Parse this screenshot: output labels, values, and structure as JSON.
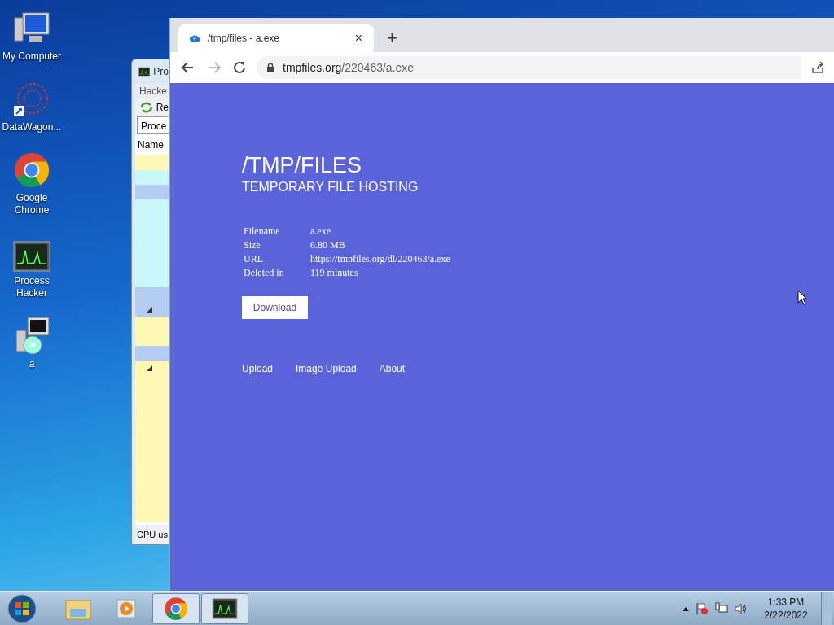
{
  "desktop_icons": [
    {
      "kind": "computer",
      "label": "My Computer"
    },
    {
      "kind": "web",
      "label": "DataWagon..."
    },
    {
      "kind": "chrome",
      "label": "Google Chrome"
    },
    {
      "kind": "monitor",
      "label": "Process Hacker"
    },
    {
      "kind": "installer",
      "label": "a"
    }
  ],
  "process_hacker": {
    "title": "Pro",
    "menu": "Hacke",
    "toolbar": "Re",
    "tab": "Proce",
    "column": "Name",
    "status": "CPU us",
    "rows": [
      {
        "color": "#fdf9b5",
        "expanded": false
      },
      {
        "color": "#c8f8fa",
        "expanded": false
      },
      {
        "color": "#b4cdf5",
        "expanded": false
      },
      {
        "color": "#c8f8fa",
        "expanded": false
      },
      {
        "color": "#c8f8fa",
        "expanded": false
      },
      {
        "color": "#c8f8fa",
        "expanded": false
      },
      {
        "color": "#c8f8fa",
        "expanded": false
      },
      {
        "color": "#c8f8fa",
        "expanded": false
      },
      {
        "color": "#c8f8fa",
        "expanded": false
      },
      {
        "color": "#b4cdf5",
        "expanded": false
      },
      {
        "color": "#b4cdf5",
        "expanded": true
      },
      {
        "color": "#fdf9b5",
        "expanded": false
      },
      {
        "color": "#fdf9b5",
        "expanded": false
      },
      {
        "color": "#b4cdf5",
        "expanded": false
      },
      {
        "color": "#fdf9b5",
        "expanded": true
      },
      {
        "color": "#fdf9b5",
        "expanded": false
      },
      {
        "color": "#fdf9b5",
        "expanded": false
      },
      {
        "color": "#fdf9b5",
        "expanded": false
      },
      {
        "color": "#fdf9b5",
        "expanded": false
      },
      {
        "color": "#fdf9b5",
        "expanded": false
      },
      {
        "color": "#fdf9b5",
        "expanded": false
      },
      {
        "color": "#fdf9b5",
        "expanded": false
      },
      {
        "color": "#fdf9b5",
        "expanded": false
      },
      {
        "color": "#fdf9b5",
        "expanded": false
      },
      {
        "color": "#fdf9b5",
        "expanded": false
      }
    ]
  },
  "browser": {
    "tab": {
      "title": "/tmp/files - a.exe",
      "close": "×"
    },
    "new_tab": "+",
    "address": {
      "host": "tmpfiles.org",
      "path": "/220463/a.exe"
    },
    "page": {
      "title": "/TMP/FILES",
      "subtitle": "TEMPORARY FILE HOSTING",
      "info": [
        {
          "label": "Filename",
          "value": "a.exe"
        },
        {
          "label": "Size",
          "value": "6.80 MB"
        },
        {
          "label": "URL",
          "value": "https://tmpfiles.org/dl/220463/a.exe"
        },
        {
          "label": "Deleted in",
          "value": "119 minutes"
        }
      ],
      "button": "Download",
      "links": [
        "Upload",
        "Image Upload",
        "About"
      ]
    }
  },
  "taskbar": {
    "items": [
      {
        "kind": "explorer",
        "selected": false
      },
      {
        "kind": "media",
        "selected": false
      },
      {
        "kind": "chrome",
        "selected": true
      },
      {
        "kind": "monitor",
        "selected": true
      }
    ],
    "time": "1:33 PM",
    "date": "2/22/2022"
  }
}
